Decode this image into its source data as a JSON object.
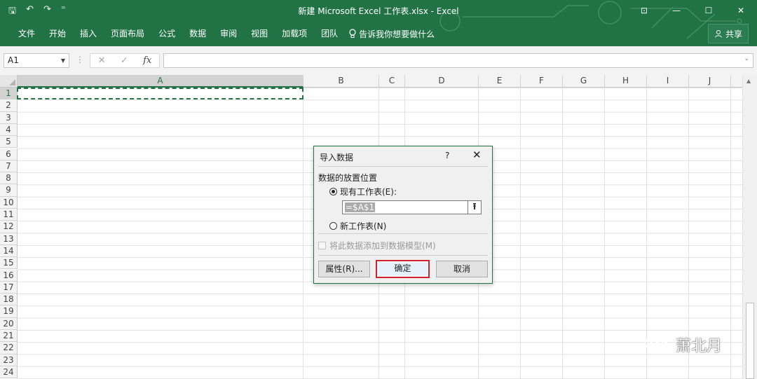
{
  "window": {
    "title": "新建 Microsoft Excel 工作表.xlsx  -  Excel",
    "controls": [
      "⊡",
      "—",
      "☐",
      "✕"
    ]
  },
  "qat": {
    "save": "🖫",
    "undo": "↶",
    "redo": "↷",
    "customize": "⁼"
  },
  "ribbon": {
    "tabs": [
      "文件",
      "开始",
      "插入",
      "页面布局",
      "公式",
      "数据",
      "审阅",
      "视图",
      "加载项",
      "团队"
    ],
    "tell_me": "告诉我你想要做什么",
    "share": "共享"
  },
  "formula_bar": {
    "name_box": "A1",
    "formula_value": "",
    "cancel_glyph": "✕",
    "enter_glyph": "✓",
    "fx_glyph": "fx"
  },
  "sheet": {
    "columns": [
      "A",
      "B",
      "C",
      "D",
      "E",
      "F",
      "G",
      "H",
      "I",
      "J"
    ],
    "rows": [
      "1",
      "2",
      "3",
      "4",
      "5",
      "6",
      "7",
      "8",
      "9",
      "10",
      "11",
      "12",
      "13",
      "14",
      "15",
      "16",
      "17",
      "18",
      "19",
      "20",
      "21",
      "22",
      "23",
      "24"
    ],
    "selected_cell": "A1"
  },
  "dialog": {
    "title": "导入数据",
    "help": "?",
    "close": "✕",
    "group_label": "数据的放置位置",
    "option_existing": "现有工作表(E):",
    "option_new": "新工作表(N)",
    "reference_value": "=$A$1",
    "collapse_glyph": "⭱",
    "add_to_model": "将此数据添加到数据模型(M)",
    "properties_button": "属性(R)...",
    "ok_button": "确定",
    "cancel_button": "取消",
    "selected_option": "existing",
    "highlight_color": "#d12030"
  },
  "watermark": {
    "text": "萧北月"
  },
  "colors": {
    "excel_green": "#217346"
  }
}
